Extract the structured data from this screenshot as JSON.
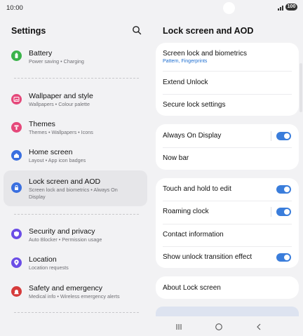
{
  "status_bar": {
    "time": "10:00",
    "battery": "100",
    "signal_icon": "signal-bars-icon"
  },
  "settings": {
    "title": "Settings",
    "search_icon": "search-icon",
    "items": [
      {
        "title": "Battery",
        "subtitle": "Power saving • Charging",
        "icon": "battery-icon",
        "color": "#3bb34a"
      },
      {
        "title": "Wallpaper and style",
        "subtitle": "Wallpapers • Colour palette",
        "icon": "wallpaper-icon",
        "color": "#e5487a"
      },
      {
        "title": "Themes",
        "subtitle": "Themes • Wallpapers • Icons",
        "icon": "themes-icon",
        "color": "#e5487a"
      },
      {
        "title": "Home screen",
        "subtitle": "Layout • App icon badges",
        "icon": "home-icon",
        "color": "#3a6fe0"
      },
      {
        "title": "Lock screen and AOD",
        "subtitle": "Screen lock and biometrics • Always On Display",
        "icon": "lock-icon",
        "color": "#3a6fe0"
      },
      {
        "title": "Security and privacy",
        "subtitle": "Auto Blocker • Permission usage",
        "icon": "shield-icon",
        "color": "#6b4de6"
      },
      {
        "title": "Location",
        "subtitle": "Location requests",
        "icon": "location-pin-icon",
        "color": "#6b4de6"
      },
      {
        "title": "Safety and emergency",
        "subtitle": "Medical info • Wireless emergency alerts",
        "icon": "emergency-icon",
        "color": "#d63b3b"
      }
    ]
  },
  "detail": {
    "title": "Lock screen and AOD",
    "groups": [
      [
        {
          "label": "Screen lock and biometrics",
          "sub": "Pattern, Fingerprints"
        },
        {
          "label": "Extend Unlock"
        },
        {
          "label": "Secure lock settings"
        }
      ],
      [
        {
          "label": "Always On Display",
          "toggle": true
        },
        {
          "label": "Now bar"
        }
      ],
      [
        {
          "label": "Touch and hold to edit",
          "toggle": true
        },
        {
          "label": "Roaming clock",
          "toggle": true
        },
        {
          "label": "Contact information"
        },
        {
          "label": "Show unlock transition effect",
          "toggle": true
        }
      ],
      [
        {
          "label": "About Lock screen"
        }
      ]
    ]
  },
  "navbar": {
    "recents_icon": "recents-icon",
    "home_icon": "home-circle-icon",
    "back_icon": "back-chevron-icon"
  },
  "colors": {
    "accent": "#3a7ddb",
    "link": "#1f6fd1",
    "background": "#f2f2f4"
  }
}
